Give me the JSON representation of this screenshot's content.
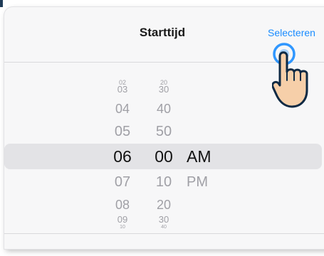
{
  "dialog": {
    "title": "Starttijd",
    "select_label": "Selecteren"
  },
  "picker": {
    "hours": [
      "02",
      "03",
      "04",
      "05",
      "06",
      "07",
      "08",
      "09",
      "10"
    ],
    "minutes": [
      "20",
      "30",
      "40",
      "50",
      "00",
      "10",
      "20",
      "30",
      "40"
    ],
    "ampm": [
      "AM",
      "PM"
    ],
    "selected": {
      "hour": "06",
      "minute": "00",
      "period": "AM"
    }
  },
  "colors": {
    "accent": "#1a8cff",
    "text": "#111111",
    "muted": "#a0a0a6",
    "selection_band": "#e3e3e6"
  },
  "icons": {
    "pointer": "hand-pointer-icon"
  }
}
